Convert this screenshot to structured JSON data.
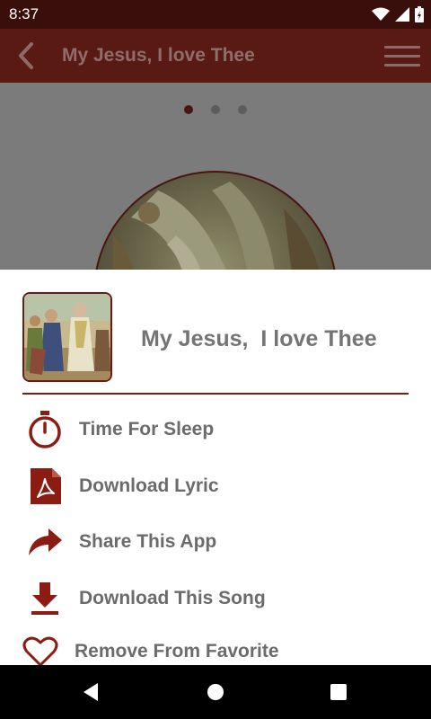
{
  "status": {
    "time": "8:37"
  },
  "app_bar": {
    "title": "My Jesus, I love Thee"
  },
  "pager": {
    "pages": 3,
    "active": 0
  },
  "sheet": {
    "title": "My Jesus,  I love Thee",
    "items": [
      {
        "label": "Time For Sleep",
        "icon": "timer-icon"
      },
      {
        "label": "Download Lyric",
        "icon": "pdf-icon"
      },
      {
        "label": "Share This App",
        "icon": "share-icon"
      },
      {
        "label": "Download This Song",
        "icon": "download-icon"
      },
      {
        "label": "Remove From Favorite",
        "icon": "heart-icon"
      }
    ]
  },
  "colors": {
    "accent": "#8b1c12",
    "app_bar": "#5a1a14",
    "status_bar": "#3a0f0b"
  }
}
